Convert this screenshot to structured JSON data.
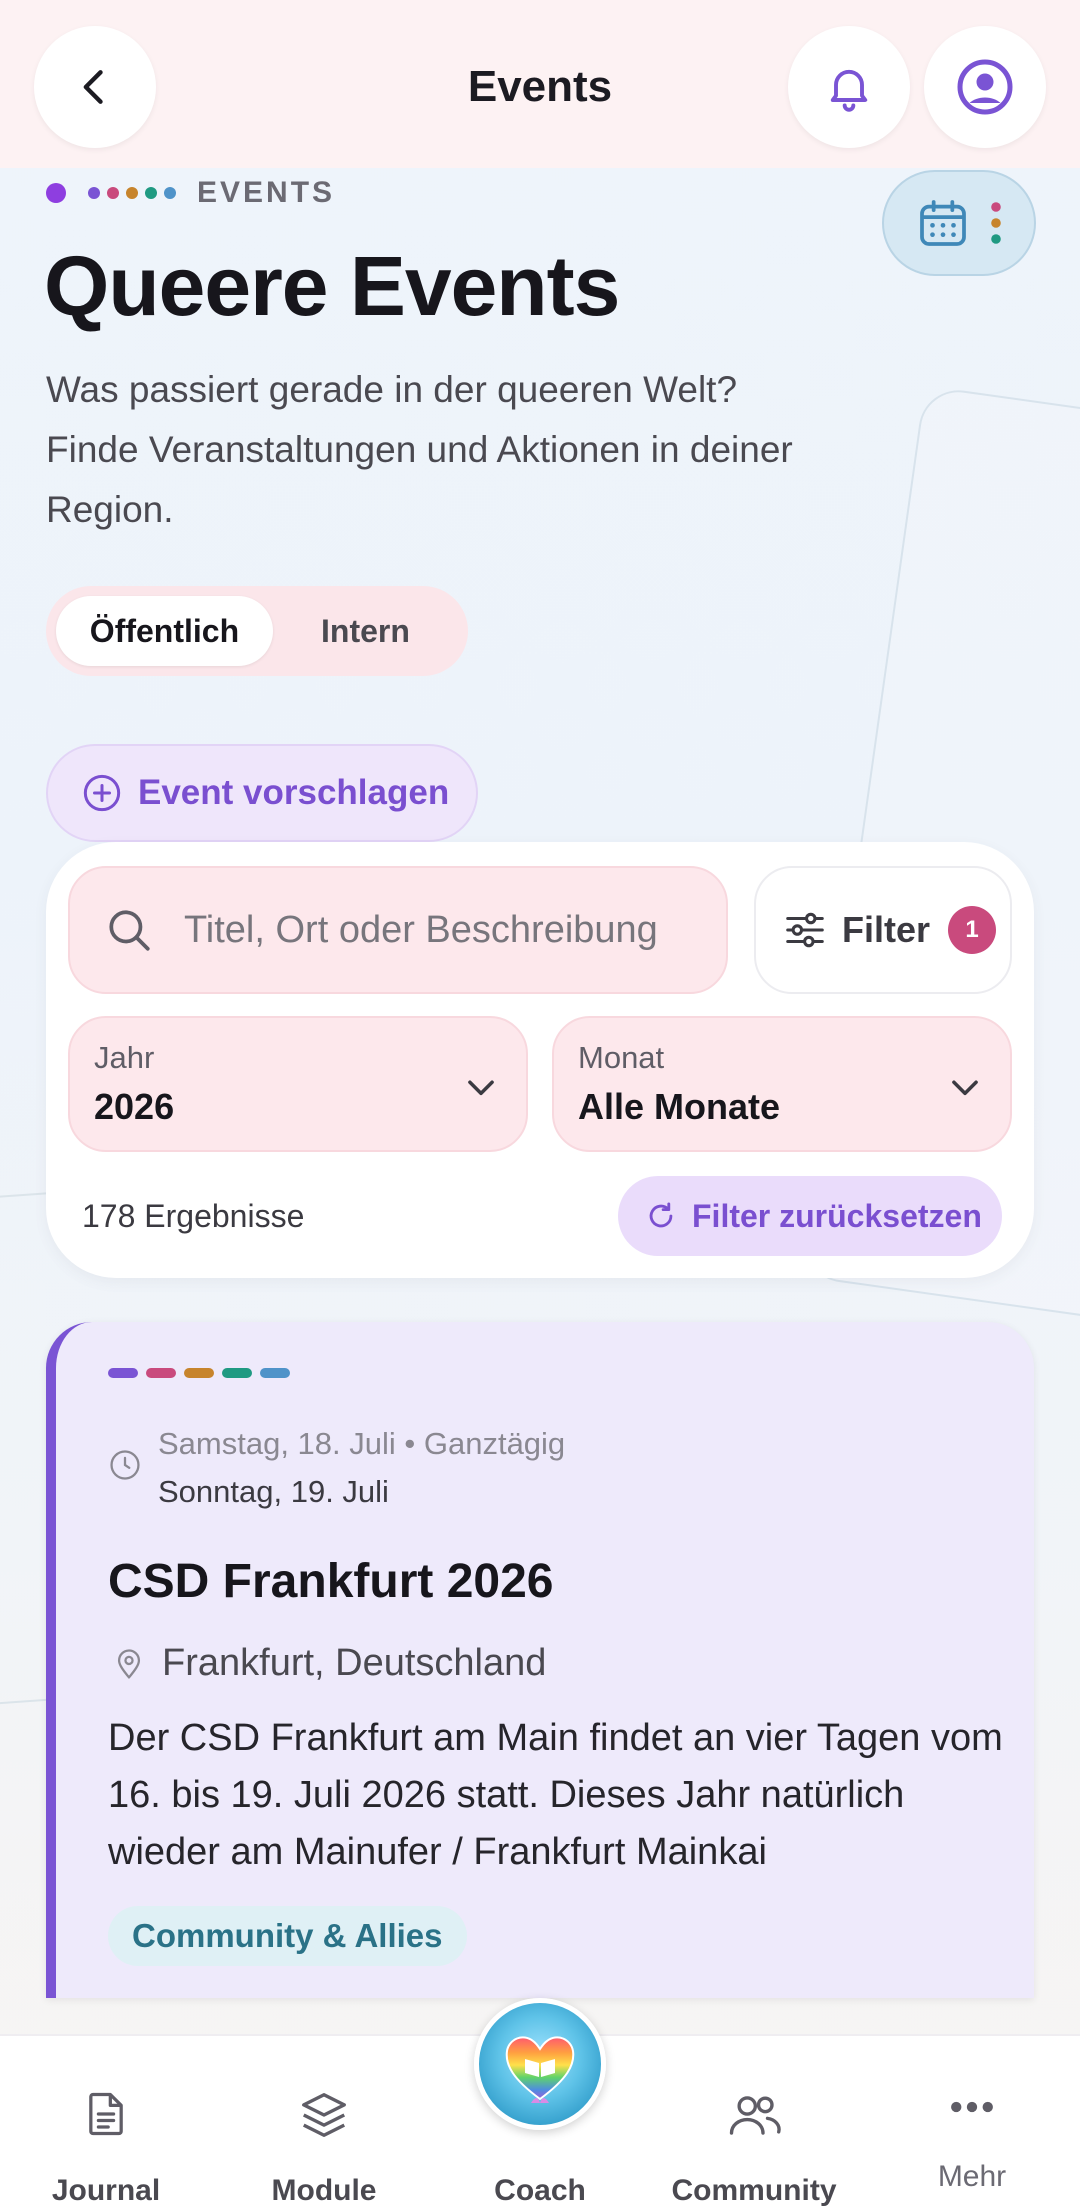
{
  "header": {
    "title": "Events"
  },
  "eyebrow": {
    "text": "EVENTS",
    "dot_colors": [
      "#8e3ee0",
      "#7a54d4",
      "#c94a7d",
      "#c7842c",
      "#1f9a82",
      "#4f93c9"
    ]
  },
  "page": {
    "title": "Queere Events",
    "subtitle": "Was passiert gerade in der queeren Welt? Finde Veranstaltungen und Aktionen in deiner Region."
  },
  "segment": {
    "options": [
      "Öffentlich",
      "Intern"
    ],
    "selected": "Öffentlich"
  },
  "suggest_button": {
    "label": "Event vorschlagen"
  },
  "filters": {
    "search_placeholder": "Titel, Ort oder Beschreibung",
    "search_value": "",
    "filter_label": "Filter",
    "filter_count": "1",
    "year_label": "Jahr",
    "year_value": "2026",
    "month_label": "Monat",
    "month_value": "Alle Monate",
    "results": "178 Ergebnisse",
    "reset_label": "Filter zurücksetzen"
  },
  "events": [
    {
      "stripe_colors": [
        "#7a54d4",
        "#c94a7d",
        "#c7842c",
        "#1f9a82",
        "#4f93c9"
      ],
      "date_start": "Samstag, 18. Juli • Ganztägig",
      "date_end": "Sonntag, 19. Juli",
      "title": "CSD Frankfurt 2026",
      "location": "Frankfurt, Deutschland",
      "description": "Der CSD Frankfurt am Main findet an vier Tagen vom 16. bis 19. Juli 2026 statt. Dieses Jahr natürlich wieder am Mainufer / Frankfurt Mainkai",
      "tag": "Community & Allies"
    }
  ],
  "bottom_nav": {
    "items": [
      {
        "label": "Journal",
        "icon": "document-icon"
      },
      {
        "label": "Module",
        "icon": "layers-icon"
      },
      {
        "label": "Coach",
        "icon": "coach-avatar"
      },
      {
        "label": "Community",
        "icon": "people-icon"
      },
      {
        "label": "Mehr",
        "icon": "more-dots-icon"
      }
    ]
  }
}
